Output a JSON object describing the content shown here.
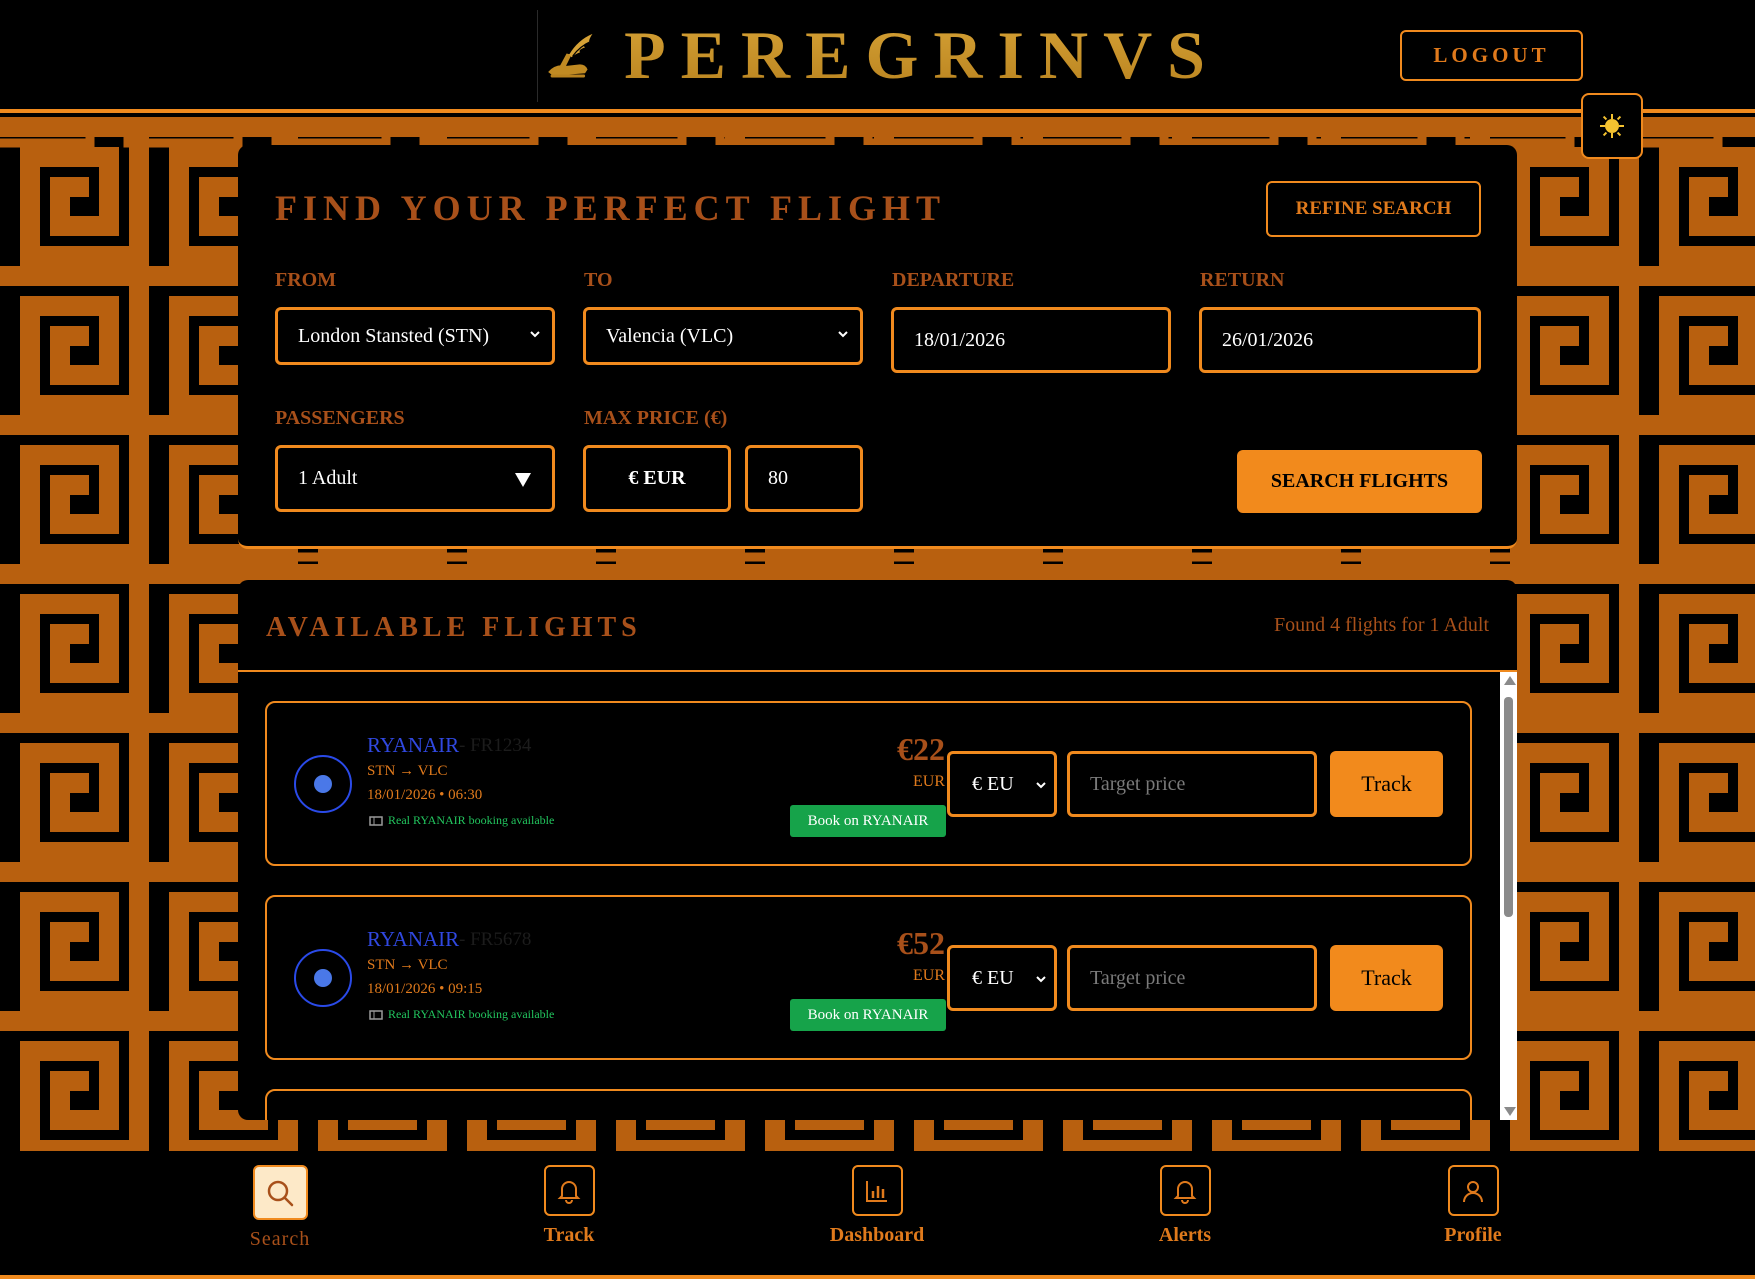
{
  "header": {
    "brand": "PEREGRINVS",
    "logout_label": "LOGOUT"
  },
  "search": {
    "title": "FIND YOUR PERFECT FLIGHT",
    "refine_label": "REFINE SEARCH",
    "from_label": "FROM",
    "from_value": "London Stansted (STN)",
    "to_label": "TO",
    "to_value": "Valencia (VLC)",
    "departure_label": "DEPARTURE",
    "departure_value": "18/01/2026",
    "return_label": "RETURN",
    "return_value": "26/01/2026",
    "passengers_label": "PASSENGERS",
    "passengers_value": "1 Adult",
    "max_price_label": "MAX PRICE (€)",
    "currency_value": "€ EUR",
    "max_price_value": "80",
    "search_label": "SEARCH FLIGHTS"
  },
  "results": {
    "title": "AVAILABLE FLIGHTS",
    "found_text": "Found 4 flights for 1 Adult",
    "flights": [
      {
        "airline": "RYANAIR",
        "flight_no": "- FR1234",
        "route": "STN → VLC",
        "datetime": "18/01/2026 • 06:30",
        "real_booking": "Real RYANAIR booking available",
        "price": "€22",
        "price_currency": "EUR",
        "book_label": "Book on RYANAIR",
        "currency_select": "€ EU",
        "target_placeholder": "Target price",
        "track_label": "Track"
      },
      {
        "airline": "RYANAIR",
        "flight_no": "- FR5678",
        "route": "STN → VLC",
        "datetime": "18/01/2026 • 09:15",
        "real_booking": "Real RYANAIR booking available",
        "price": "€52",
        "price_currency": "EUR",
        "book_label": "Book on RYANAIR",
        "currency_select": "€ EU",
        "target_placeholder": "Target price",
        "track_label": "Track"
      }
    ]
  },
  "nav": {
    "items": [
      {
        "label": "Search",
        "icon": "search-icon",
        "active": true
      },
      {
        "label": "Track",
        "icon": "bell-icon"
      },
      {
        "label": "Dashboard",
        "icon": "bar-chart-icon"
      },
      {
        "label": "Alerts",
        "icon": "bell-icon"
      },
      {
        "label": "Profile",
        "icon": "user-icon"
      }
    ]
  },
  "colors": {
    "accent": "#f08a1e",
    "accent_dark": "#a8501a",
    "gold": "#c08a22",
    "pattern": "#b8600f",
    "airline_blue": "#3048e0",
    "book_green": "#16a34a"
  }
}
